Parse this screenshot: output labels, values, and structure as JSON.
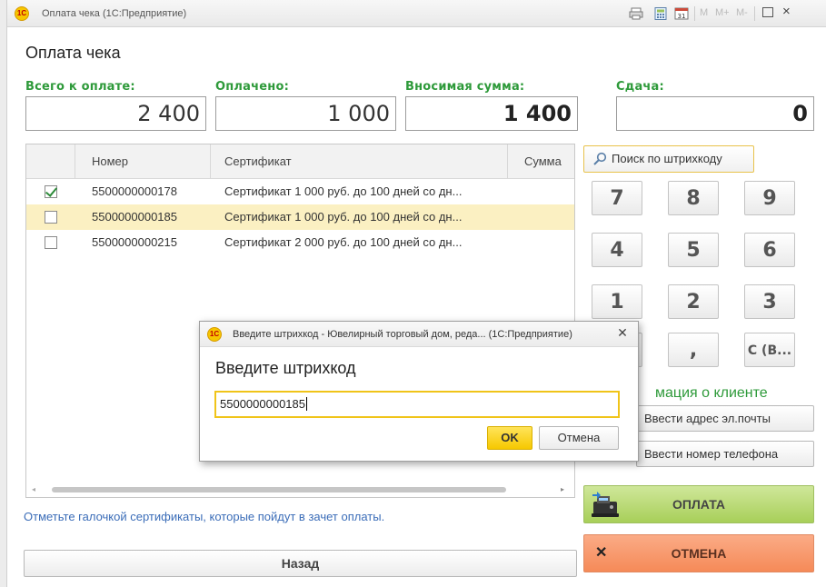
{
  "window": {
    "title": "Оплата чека  (1С:Предприятие)",
    "toolbar": [
      "M",
      "M+",
      "M-"
    ]
  },
  "page": {
    "heading": "Оплата чека"
  },
  "summary": {
    "total_label": "Всего к оплате:",
    "total_value": "2 400",
    "paid_label": "Оплачено:",
    "paid_value": "1 000",
    "deposit_label": "Вносимая сумма:",
    "deposit_value": "1 400",
    "change_label": "Сдача:",
    "change_value": "0"
  },
  "table": {
    "columns": [
      "Номер",
      "Сертификат",
      "Сумма"
    ],
    "rows": [
      {
        "checked": true,
        "number": "5500000000178",
        "certificate": "Сертификат 1 000 руб. до 100 дней со дн...",
        "sum": ""
      },
      {
        "checked": false,
        "number": "5500000000185",
        "certificate": "Сертификат 1 000 руб. до 100 дней со дн...",
        "sum": ""
      },
      {
        "checked": false,
        "number": "5500000000215",
        "certificate": "Сертификат 2 000 руб. до 100 дней со дн...",
        "sum": ""
      }
    ],
    "selected_row": 1
  },
  "hint": "Отметьте галочкой сертификаты, которые пойдут в зачет оплаты.",
  "back_button": "Назад",
  "search_button": "Поиск по штрихкоду",
  "keypad": {
    "keys": [
      "7",
      "8",
      "9",
      "4",
      "5",
      "6",
      "1",
      "2",
      "3",
      "",
      ",",
      "С (В..."
    ]
  },
  "client_section": {
    "label": "мация о клиенте",
    "email_button": "Ввести адрес эл.почты",
    "phone_button": "Ввести номер телефона"
  },
  "pay_button": "ОПЛАТА",
  "cancel_button": "ОТМЕНА",
  "dialog": {
    "title": "Введите штрихкод - Ювелирный торговый дом, реда...  (1С:Предприятие)",
    "heading": "Введите штрихкод",
    "input_value": "5500000000185",
    "ok_label": "OK",
    "cancel_label": "Отмена"
  },
  "colors": {
    "accent_green": "#2e9a3a",
    "selected_row": "#fbf0c2",
    "pay_green": "#a8cf59",
    "cancel_orange": "#f58a58",
    "ok_yellow": "#f6c800"
  }
}
